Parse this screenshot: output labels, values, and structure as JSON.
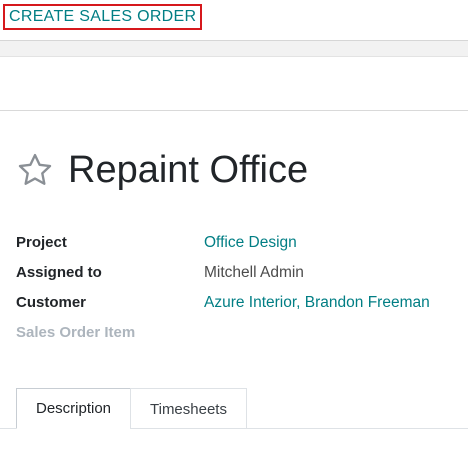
{
  "toolbar": {
    "create_sales_order_label": "CREATE SALES ORDER"
  },
  "record": {
    "title": "Repaint Office",
    "favorite_icon": "star-outline-icon"
  },
  "fields": {
    "project": {
      "label": "Project",
      "value": "Office Design"
    },
    "assigned_to": {
      "label": "Assigned to",
      "value": "Mitchell Admin"
    },
    "customer": {
      "label": "Customer",
      "value": "Azure Interior, Brandon Freeman"
    },
    "sales_order_item": {
      "label": "Sales Order Item",
      "value": ""
    }
  },
  "tabs": [
    {
      "label": "Description",
      "active": true
    },
    {
      "label": "Timesheets",
      "active": false
    }
  ],
  "colors": {
    "accent": "#017e84",
    "highlight_border": "#d6181c",
    "muted_label": "#adb5bd"
  }
}
